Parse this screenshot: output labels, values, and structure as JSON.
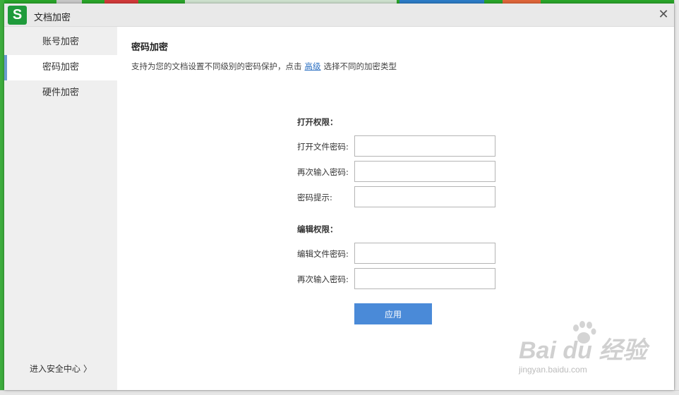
{
  "dialog": {
    "title": "文档加密",
    "logo_letter": "S",
    "close_glyph": "✕"
  },
  "sidebar": {
    "items": [
      {
        "label": "账号加密",
        "active": false
      },
      {
        "label": "密码加密",
        "active": true
      },
      {
        "label": "硬件加密",
        "active": false
      }
    ],
    "security_center": "进入安全中心",
    "security_center_chevron": "〉"
  },
  "main": {
    "heading": "密码加密",
    "desc_prefix": "支持为您的文档设置不同级别的密码保护，点击",
    "desc_link": "高级",
    "desc_suffix": "选择不同的加密类型",
    "open_section": "打开权限：",
    "open_password_label": "打开文件密码:",
    "open_repeat_label": "再次输入密码:",
    "hint_label": "密码提示:",
    "edit_section": "编辑权限：",
    "edit_password_label": "编辑文件密码:",
    "edit_repeat_label": "再次输入密码:",
    "apply_label": "应用"
  },
  "watermark": {
    "logo": "Bai du 经验",
    "url": "jingyan.baidu.com"
  },
  "colors": {
    "accent": "#4a8ad8",
    "link": "#2b6fc2",
    "logo_green": "#1f9b3b",
    "active_marker": "#6b9bd1"
  }
}
